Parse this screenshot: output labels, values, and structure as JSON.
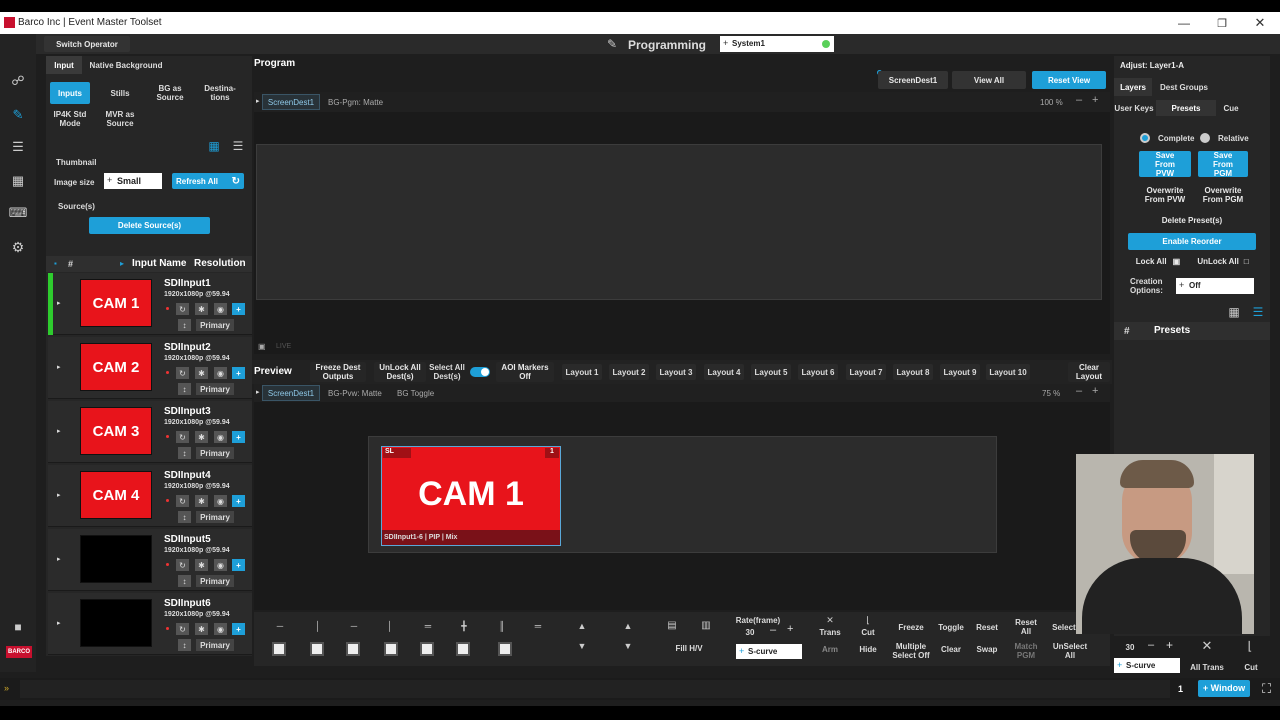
{
  "window": {
    "title": "Barco Inc | Event Master Toolset"
  },
  "header": {
    "switch_operator": "Switch Operator",
    "mode_title": "Programming",
    "system": "System1"
  },
  "left": {
    "tabs": [
      "Input",
      "Native Background"
    ],
    "sub_tabs": {
      "inputs": "Inputs",
      "stills": "Stills",
      "bg_as_source": "BG as Source",
      "destinations": "Destina-tions",
      "ip4k": "IP4K Std Mode",
      "mvr": "MVR as Source"
    },
    "thumbnail_label": "Thumbnail",
    "image_size_label": "Image size",
    "image_size_value": "Small",
    "refresh_all": "Refresh All",
    "sources_label": "Source(s)",
    "delete_sources": "Delete Source(s)",
    "list_header": {
      "num": "#",
      "name": "Input Name",
      "resolution": "Resolution"
    },
    "rows": [
      {
        "thumb": "CAM 1",
        "name": "SDIInput1",
        "res": "1920x1080p @59.94",
        "tag": "Primary"
      },
      {
        "thumb": "CAM 2",
        "name": "SDIInput2",
        "res": "1920x1080p @59.94",
        "tag": "Primary"
      },
      {
        "thumb": "CAM 3",
        "name": "SDIInput3",
        "res": "1920x1080p @59.94",
        "tag": "Primary"
      },
      {
        "thumb": "CAM 4",
        "name": "SDIInput4",
        "res": "1920x1080p @59.94",
        "tag": "Primary"
      },
      {
        "thumb": "",
        "name": "SDIInput5",
        "res": "1920x1080p @59.94",
        "tag": "Primary"
      },
      {
        "thumb": "",
        "name": "SDIInput6",
        "res": "1920x1080p @59.94",
        "tag": "Primary"
      }
    ]
  },
  "program": {
    "title": "Program",
    "screen_dest": "ScreenDest1",
    "view_all": "View All",
    "reset_view": "Reset View",
    "tab_dest": "ScreenDest1",
    "bg_label": "BG-Pgm: Matte",
    "zoom": "100 %",
    "live": "LIVE"
  },
  "preview": {
    "title": "Preview",
    "freeze": "Freeze Dest Outputs",
    "unlock_all": "UnLock All Dest(s)",
    "select_all": "Select All Dest(s)",
    "aoi": "AOI Markers Off",
    "layouts": [
      "Layout 1",
      "Layout 2",
      "Layout 3",
      "Layout 4",
      "Layout 5",
      "Layout 6",
      "Layout 7",
      "Layout 8",
      "Layout 9",
      "Layout 10"
    ],
    "clear_layout": "Clear Layout",
    "tab_dest": "ScreenDest1",
    "bg_label": "BG-Pvw: Matte",
    "bg_toggle": "BG Toggle",
    "zoom": "75 %",
    "layer": {
      "tag": "SL",
      "num": "1",
      "content": "CAM 1",
      "caption": "SDIInput1-6 | PIP | Mix"
    }
  },
  "toolbar": {
    "rate_label": "Rate(frame)",
    "rate_value": "30",
    "fill": "Fill H/V",
    "curve": "S-curve",
    "trans": "Trans",
    "cut": "Cut",
    "arm": "Arm",
    "hide": "Hide",
    "freeze": "Freeze",
    "toggle": "Toggle",
    "reset": "Reset",
    "reset_all": "Reset All",
    "select_all": "Select All",
    "multiple_select": "Multiple Select Off",
    "clear": "Clear",
    "swap": "Swap",
    "match_pgm": "Match PGM",
    "unselect_all": "UnSelect All"
  },
  "right": {
    "adjust": "Adjust: Layer1-A",
    "tabs": [
      "Layers",
      "Dest Groups"
    ],
    "sub_tabs": [
      "User Keys",
      "Presets",
      "Cue"
    ],
    "complete": "Complete",
    "relative": "Relative",
    "save_pvw": "Save From PVW",
    "save_pgm": "Save From PGM",
    "overwrite_pvw": "Overwrite From PVW",
    "overwrite_pgm": "Overwrite From PGM",
    "delete_preset": "Delete Preset(s)",
    "enable_reorder": "Enable Reorder",
    "lock_all": "Lock All",
    "unlock_all": "UnLock All",
    "creation_options": "Creation Options:",
    "creation_value": "Off",
    "presets_header": {
      "num": "#",
      "title": "Presets"
    },
    "rate": "30",
    "curve": "S-curve",
    "all_trans": "All Trans",
    "cut": "Cut"
  },
  "status": {
    "page": "1",
    "window": "+ Window"
  },
  "side_icons": [
    "binoculars-icon",
    "edit-icon",
    "list-icon",
    "grid-icon",
    "keyboard-icon",
    "gear-icon",
    "save-icon"
  ],
  "brand": "BARCO"
}
